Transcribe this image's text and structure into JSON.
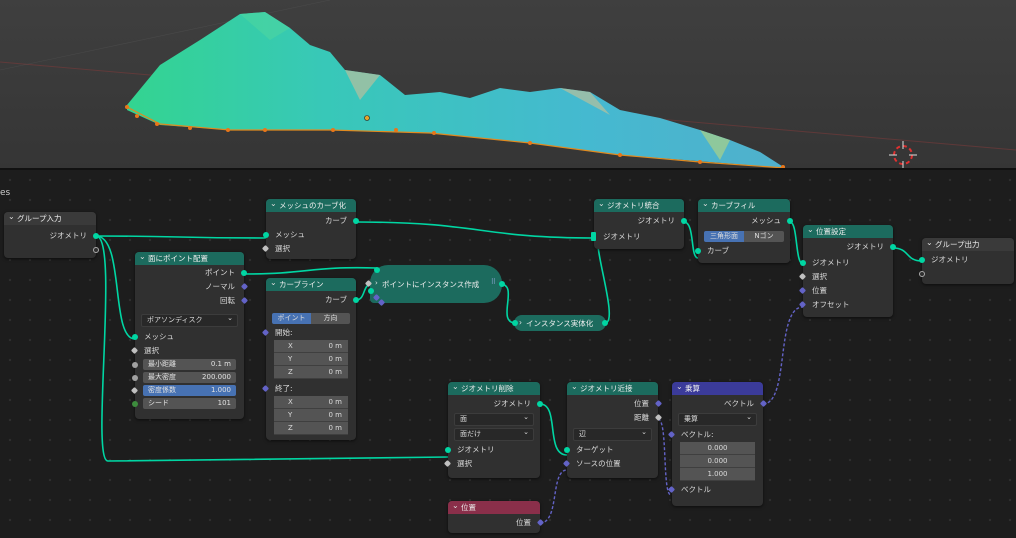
{
  "panel_edge_text": "es",
  "nodes": {
    "group_input": {
      "title": "グループ入力",
      "geometry": "ジオメトリ"
    },
    "group_output": {
      "title": "グループ出力",
      "geometry": "ジオメトリ"
    },
    "mesh_to_curve": {
      "title": "メッシュのカーブ化",
      "curve": "カーブ",
      "mesh": "メッシュ",
      "selection": "選択"
    },
    "distribute_points": {
      "title": "面にポイント配置",
      "points": "ポイント",
      "normal": "ノーマル",
      "rotation": "回転",
      "mode": "ポアソンディスク",
      "mesh": "メッシュ",
      "selection": "選択",
      "fields": [
        {
          "label": "最小距離",
          "value": "0.1 m"
        },
        {
          "label": "最大密度",
          "value": "200.000"
        },
        {
          "label": "密度係数",
          "value": "1.000"
        },
        {
          "label": "シード",
          "value": "101"
        }
      ]
    },
    "curve_line": {
      "title": "カーブライン",
      "curve": "カーブ",
      "mode_a": "ポイント",
      "mode_b": "方向",
      "start": "開始:",
      "end": "終了:",
      "start_vals": [
        {
          "axis": "X",
          "value": "0 m"
        },
        {
          "axis": "Y",
          "value": "0 m"
        },
        {
          "axis": "Z",
          "value": "0 m"
        }
      ],
      "end_vals": [
        {
          "axis": "X",
          "value": "0 m"
        },
        {
          "axis": "Y",
          "value": "0 m"
        },
        {
          "axis": "Z",
          "value": "0 m"
        }
      ]
    },
    "instance_on_points": {
      "title": "ポイントにインスタンス作成"
    },
    "realize_instances": {
      "title": "インスタンス実体化"
    },
    "join_geometry": {
      "title": "ジオメトリ統合",
      "geometry_out": "ジオメトリ",
      "geometry_in": "ジオメトリ"
    },
    "fill_curve": {
      "title": "カーブフィル",
      "mesh": "メッシュ",
      "mode_a": "三角形面",
      "mode_b": "Nゴン",
      "curve": "カーブ"
    },
    "set_position": {
      "title": "位置設定",
      "geometry_out": "ジオメトリ",
      "geometry_in": "ジオメトリ",
      "selection": "選択",
      "position": "位置",
      "offset": "オフセット"
    },
    "delete_geometry": {
      "title": "ジオメトリ削除",
      "geometry_out": "ジオメトリ",
      "domain": "面",
      "mode": "面だけ",
      "geometry_in": "ジオメトリ",
      "selection": "選択"
    },
    "geometry_proximity": {
      "title": "ジオメトリ近接",
      "position": "位置",
      "distance": "距離",
      "target_element": "辺",
      "target": "ターゲット",
      "source_position": "ソースの位置"
    },
    "multiply": {
      "title": "乗算",
      "vector_out": "ベクトル",
      "operation": "乗算",
      "vector_label": "ベクトル:",
      "values": [
        "0.000",
        "0.000",
        "1.000"
      ],
      "vector_in": "ベクトル"
    },
    "position": {
      "title": "位置",
      "position": "位置"
    }
  },
  "colors": {
    "geometry_socket": "#00d6a3",
    "vector_socket": "#6363c7",
    "geometry_header": "#1c6b5e",
    "math_header": "#3b3b9a",
    "input_header": "#8a2f4a",
    "selected_blue": "#4772b3"
  }
}
